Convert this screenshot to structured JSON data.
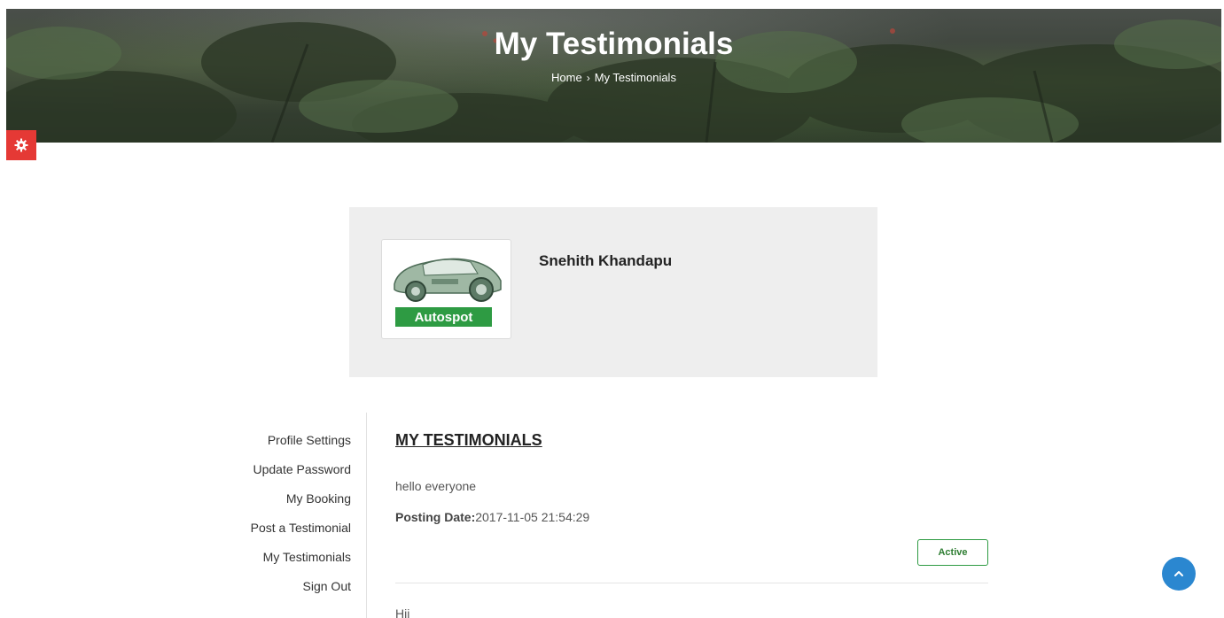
{
  "header": {
    "title": "My Testimonials",
    "breadcrumb": {
      "home": "Home",
      "separator": "›",
      "current": "My Testimonials"
    }
  },
  "settings_icon": "gear-icon",
  "profile": {
    "name": "Snehith Khandapu",
    "avatar_label": "Autospot"
  },
  "sidebar": {
    "items": [
      {
        "label": "Profile Settings"
      },
      {
        "label": "Update Password"
      },
      {
        "label": "My Booking"
      },
      {
        "label": "Post a Testimonial"
      },
      {
        "label": "My Testimonials"
      },
      {
        "label": "Sign Out"
      }
    ]
  },
  "main": {
    "section_title": "MY TESTIMONIALS",
    "testimonials": [
      {
        "text": "hello everyone",
        "posting_date_label": "Posting Date:",
        "posting_date": "2017-11-05 21:54:29",
        "status": "Active"
      },
      {
        "text": "Hii"
      }
    ]
  },
  "scroll_top_icon": "chevron-up-icon",
  "colors": {
    "accent_red": "#e53935",
    "brand_green": "#2e9b43",
    "scroll_blue": "#2b87d0",
    "card_bg": "#eeeeee"
  }
}
